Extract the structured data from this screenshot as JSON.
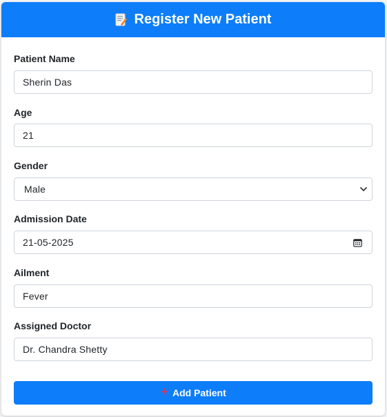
{
  "header": {
    "title": "Register New Patient",
    "icon": "memo-icon"
  },
  "form": {
    "patient_name": {
      "label": "Patient Name",
      "value": "Sherin Das"
    },
    "age": {
      "label": "Age",
      "value": "21"
    },
    "gender": {
      "label": "Gender",
      "value": "Male"
    },
    "admission_date": {
      "label": "Admission Date",
      "value": "21-05-2025"
    },
    "ailment": {
      "label": "Ailment",
      "value": "Fever"
    },
    "assigned_doctor": {
      "label": "Assigned Doctor",
      "value": "Dr. Chandra Shetty"
    }
  },
  "submit": {
    "label": "Add Patient",
    "icon": "plus-icon"
  },
  "colors": {
    "primary": "#0d7df9",
    "plus": "#e8334a"
  }
}
